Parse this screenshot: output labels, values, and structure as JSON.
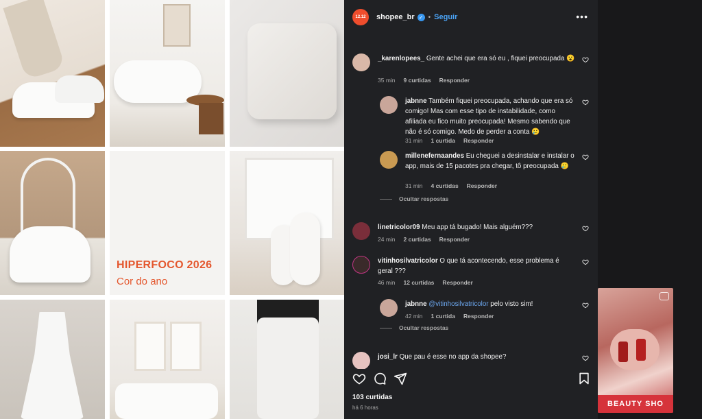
{
  "grid": {
    "promo_title": "HIPERFOCO 2026",
    "promo_subtitle": "Cor do ano"
  },
  "post": {
    "account": "shopee_br",
    "follow_label": "Seguir",
    "more_icon": "more-options-icon",
    "likes": "103 curtidas",
    "time": "há 6 horas"
  },
  "comments": [
    {
      "user": "_karenlopees_",
      "text": "Gente achei que era só eu , fiquei preocupada 😮",
      "time": "35 min",
      "likes": "9 curtidas",
      "reply": "Responder",
      "avatar_color": "#d9b8a8"
    },
    {
      "user": "jabnne",
      "text": "Também fiquei preocupada, achando que era só comigo! Mas com esse tipo de instabilidade, como afiliada eu fico muito preocupada! Mesmo sabendo que não é só comigo. Medo de perder a conta 🥲",
      "time": "31 min",
      "likes": "1 curtida",
      "reply": "Responder",
      "avatar_color": "#c9a69a"
    },
    {
      "user": "millenefernaandes",
      "text": "Eu cheguei a desinstalar e instalar o app, mais de 15 pacotes pra chegar, tô preocupada 🥲",
      "time": "31 min",
      "likes": "4 curtidas",
      "reply": "Responder",
      "avatar_color": "#c99a52"
    },
    {
      "user": "linetricolor09",
      "text": "Meu app tá bugado! Mais alguém???",
      "time": "24 min",
      "likes": "2 curtidas",
      "reply": "Responder",
      "avatar_color": "#7a2e3a"
    },
    {
      "user": "vitinhosilvatricolor",
      "text": "O que tá acontecendo, esse problema é geral ???",
      "time": "46 min",
      "likes": "12 curtidas",
      "reply": "Responder",
      "avatar_color": "#3a2a2a"
    },
    {
      "user": "jabnne",
      "mention": "@vitinhosilvatricolor",
      "text": " pelo visto sim!",
      "time": "42 min",
      "likes": "1 curtida",
      "reply": "Responder",
      "avatar_color": "#c9a69a"
    },
    {
      "user": "josi_lr",
      "text": "Que pau é esse no app da shopee?",
      "avatar_color": "#e6c3c0"
    }
  ],
  "hide_replies": "Ocultar respostas",
  "side": {
    "banner": "BEAUTY SHO"
  },
  "colors": {
    "panel_bg": "#202124",
    "accent": "#4ba3f5",
    "brand": "#ee4d2d",
    "promo": "#e4572e"
  }
}
